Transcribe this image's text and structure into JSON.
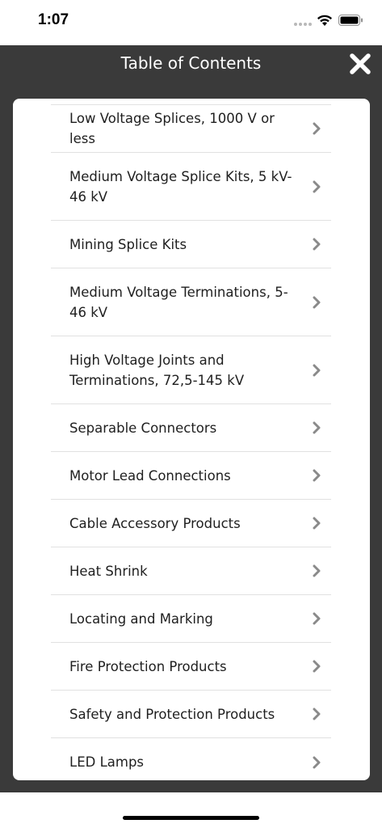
{
  "status_bar": {
    "time": "1:07"
  },
  "header": {
    "title": "Table of Contents",
    "close_icon": "close-x-icon"
  },
  "toc": {
    "items": [
      {
        "label": "Low Voltage Splices, 1000 V or less",
        "lines": 1
      },
      {
        "label": "Medium Voltage Splice Kits, 5 kV-46 kV",
        "lines": 2
      },
      {
        "label": "Mining Splice Kits",
        "lines": 1
      },
      {
        "label": "Medium Voltage Terminations, 5-46 kV",
        "lines": 2
      },
      {
        "label": "High Voltage Joints and Terminations, 72,5-145 kV",
        "lines": 2
      },
      {
        "label": "Separable Connectors",
        "lines": 1
      },
      {
        "label": "Motor Lead Connections",
        "lines": 1
      },
      {
        "label": "Cable Accessory Products",
        "lines": 1
      },
      {
        "label": "Heat Shrink",
        "lines": 1
      },
      {
        "label": "Locating and Marking",
        "lines": 1
      },
      {
        "label": "Fire Protection Products",
        "lines": 1
      },
      {
        "label": "Safety and Protection Products",
        "lines": 1
      },
      {
        "label": "LED Lamps",
        "lines": 1
      }
    ],
    "chevron_icon": "chevron-right-icon"
  },
  "colors": {
    "overlay": "#3a3a3a",
    "panel": "#ffffff",
    "divider": "#e1e1e1",
    "chevron": "#8a8a8a"
  }
}
